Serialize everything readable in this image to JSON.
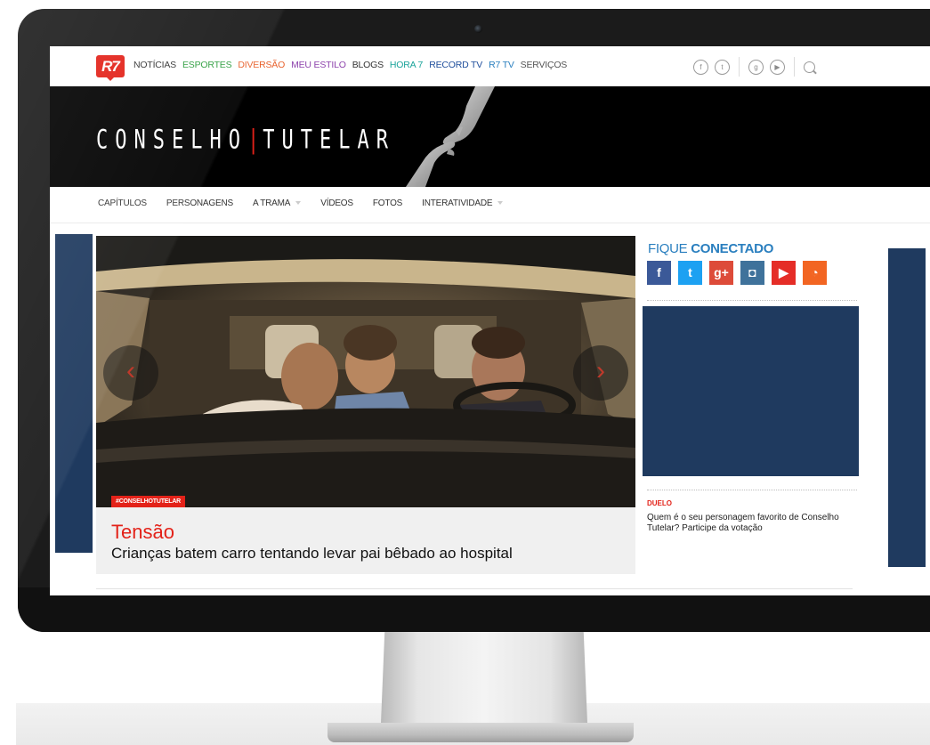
{
  "topnav": {
    "logo": "R7",
    "items": [
      {
        "label": "NOTÍCIAS",
        "color": "#333333"
      },
      {
        "label": "ESPORTES",
        "color": "#2e9e3f"
      },
      {
        "label": "DIVERSÃO",
        "color": "#e8612c"
      },
      {
        "label": "MEU ESTILO",
        "color": "#8e44ad"
      },
      {
        "label": "BLOGS",
        "color": "#333333"
      },
      {
        "label": "HORA 7",
        "color": "#1aa39a"
      },
      {
        "label": "RECORD TV",
        "color": "#1f4e9c"
      },
      {
        "label": "R7 TV",
        "color": "#2a7fbf"
      },
      {
        "label": "SERVIÇOS",
        "color": "#555555"
      }
    ],
    "social_icons": [
      "facebook-icon",
      "twitter-icon",
      "google-plus-icon",
      "youtube-icon",
      "search-icon"
    ]
  },
  "banner": {
    "title_left": "CONSELHO",
    "title_right": "TUTELAR"
  },
  "subnav": {
    "items": [
      {
        "label": "CAPÍTULOS",
        "dropdown": false
      },
      {
        "label": "PERSONAGENS",
        "dropdown": false
      },
      {
        "label": "A TRAMA",
        "dropdown": true
      },
      {
        "label": "VÍDEOS",
        "dropdown": false
      },
      {
        "label": "FOTOS",
        "dropdown": false
      },
      {
        "label": "INTERATIVIDADE",
        "dropdown": true
      }
    ]
  },
  "hero": {
    "hashtag": "#CONSELHOTUTELAR",
    "kicker": "Tensão",
    "headline": "Crianças batem carro tentando levar pai bêbado ao hospital",
    "prev_label": "‹",
    "next_label": "›"
  },
  "sidebar": {
    "fique_light": "FIQUE",
    "fique_bold": "CONECTADO",
    "social": [
      {
        "icon": "facebook-icon",
        "glyph": "f",
        "color": "#3b5998"
      },
      {
        "icon": "twitter-icon",
        "glyph": "t",
        "color": "#1da1f2"
      },
      {
        "icon": "google-plus-icon",
        "glyph": "g+",
        "color": "#dd4b39"
      },
      {
        "icon": "instagram-icon",
        "glyph": "◘",
        "color": "#3f729b"
      },
      {
        "icon": "youtube-icon",
        "glyph": "▶",
        "color": "#e52d27"
      },
      {
        "icon": "rss-icon",
        "glyph": "◔",
        "color": "#f26522"
      }
    ],
    "duelo_label": "DUELO",
    "duelo_text": "Quem é o seu personagem favorito de Conselho Tutelar? Participe da votação"
  },
  "colors": {
    "brand_red": "#e32219",
    "banner_navy": "#1f3a5f",
    "link_blue": "#2a7fbf"
  }
}
